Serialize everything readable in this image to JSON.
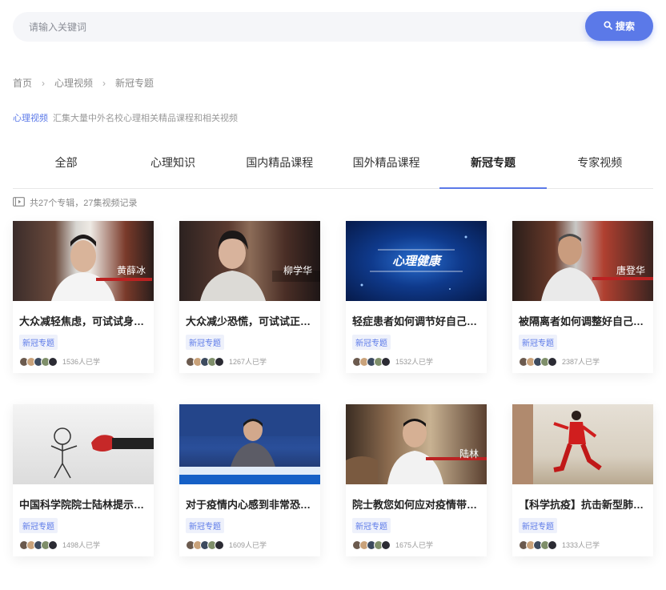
{
  "search": {
    "placeholder": "请输入关键词",
    "button_label": "搜索"
  },
  "breadcrumb": [
    "首页",
    "心理视频",
    "新冠专题"
  ],
  "intro": {
    "highlight": "心理视频",
    "text": "汇集大量中外名校心理相关精品课程和相关视频"
  },
  "tabs": [
    {
      "label": "全部",
      "active": false
    },
    {
      "label": "心理知识",
      "active": false
    },
    {
      "label": "国内精品课程",
      "active": false
    },
    {
      "label": "国外精品课程",
      "active": false
    },
    {
      "label": "新冠专题",
      "active": true
    },
    {
      "label": "专家视频",
      "active": false
    }
  ],
  "summary": "共27个专辑，27集视频记录",
  "colors": {
    "accent": "#5b79e8"
  },
  "cards": [
    {
      "title": "大众减轻焦虑，可试试身体…",
      "tag": "新冠专题",
      "learned": "1536人已学",
      "thumb_caption": "黄薛冰"
    },
    {
      "title": "大众减少恐慌，可试试正念…",
      "tag": "新冠专题",
      "learned": "1267人已学",
      "thumb_caption": "柳学华"
    },
    {
      "title": "轻症患者如何调节好自己的…",
      "tag": "新冠专题",
      "learned": "1532人已学",
      "thumb_caption": "心理健康"
    },
    {
      "title": "被隔离者如何调整好自己的…",
      "tag": "新冠专题",
      "learned": "2387人已学",
      "thumb_caption": "唐登华"
    },
    {
      "title": "中国科学院院士陆林提示：…",
      "tag": "新冠专题",
      "learned": "1498人已学",
      "thumb_caption": ""
    },
    {
      "title": "对于疫情内心感到非常恐惧…",
      "tag": "新冠专题",
      "learned": "1609人已学",
      "thumb_caption": ""
    },
    {
      "title": "院士教您如何应对疫情带来…",
      "tag": "新冠专题",
      "learned": "1675人已学",
      "thumb_caption": "陆林"
    },
    {
      "title": "【科学抗疫】抗击新型肺炎…",
      "tag": "新冠专题",
      "learned": "1333人已学",
      "thumb_caption": ""
    }
  ]
}
